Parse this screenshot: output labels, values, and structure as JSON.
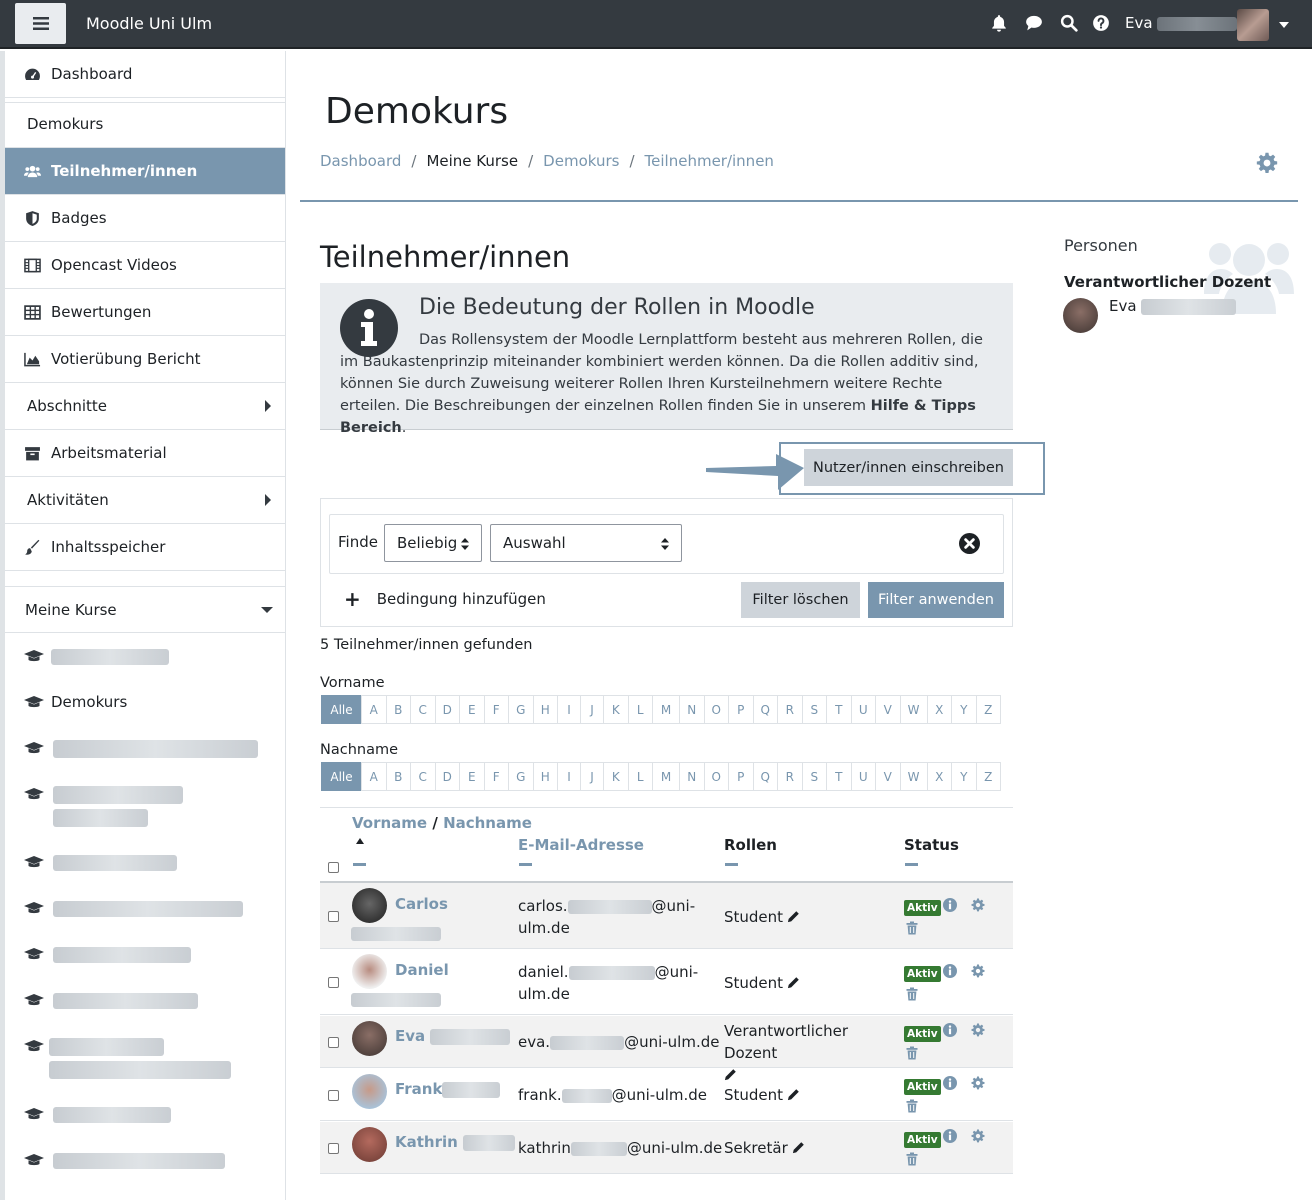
{
  "navbar": {
    "brand": "Moodle Uni Ulm",
    "user_name": "Eva"
  },
  "drawer": {
    "items": [
      {
        "label": "Dashboard",
        "icon": "dashboard-icon"
      },
      {
        "label": "Demokurs"
      },
      {
        "label": "Teilnehmer/innen",
        "icon": "users-icon",
        "active": true
      },
      {
        "label": "Badges",
        "icon": "shield-icon"
      },
      {
        "label": "Opencast Videos",
        "icon": "film-icon"
      },
      {
        "label": "Bewertungen",
        "icon": "table-icon"
      },
      {
        "label": "Votierübung Bericht",
        "icon": "area-chart-icon"
      },
      {
        "label": "Abschnitte"
      },
      {
        "label": "Arbeitsmaterial",
        "icon": "archive-icon"
      },
      {
        "label": "Aktivitäten"
      },
      {
        "label": "Inhaltsspeicher",
        "icon": "paint-brush-icon"
      }
    ],
    "my_courses_label": "Meine Kurse",
    "demokurs_course": "Demokurs"
  },
  "header": {
    "course_title": "Demokurs",
    "breadcrumb": [
      "Dashboard",
      "Meine Kurse",
      "Demokurs",
      "Teilnehmer/innen"
    ]
  },
  "main": {
    "heading": "Teilnehmer/innen",
    "info_title": "Die Bedeutung der Rollen in Moodle",
    "info_text": "Das Rollensystem der Moodle Lernplattform besteht aus mehreren Rollen, die im Baukastenprinzip miteinander kombiniert werden können. Da die Rollen additiv sind, können Sie durch Zuweisung weiterer Rollen Ihren Kursteilnehmern weitere Rechte erteilen. Die Beschreibungen der einzelnen Rollen finden Sie in unserem ",
    "info_link": "Hilfe & Tipps Bereich",
    "info_end": ".",
    "enrol_button": "Nutzer/innen einschreiben"
  },
  "filter": {
    "finde_label": "Finde",
    "match_select": "Beliebig",
    "type_select": "Auswahl",
    "add_condition": "Bedingung hinzufügen",
    "clear_button": "Filter löschen",
    "apply_button": "Filter anwenden"
  },
  "results": {
    "count_text": "5 Teilnehmer/innen gefunden"
  },
  "initials": {
    "firstname_label": "Vorname",
    "lastname_label": "Nachname",
    "all_label": "Alle",
    "letters": [
      "A",
      "B",
      "C",
      "D",
      "E",
      "F",
      "G",
      "H",
      "I",
      "J",
      "K",
      "L",
      "M",
      "N",
      "O",
      "P",
      "Q",
      "R",
      "S",
      "T",
      "U",
      "V",
      "W",
      "X",
      "Y",
      "Z"
    ]
  },
  "table": {
    "col_firstname": "Vorname",
    "col_slash": "/",
    "col_lastname": "Nachname",
    "col_email": "E-Mail-Adresse",
    "col_roles": "Rollen",
    "col_status": "Status",
    "status_badge": "Aktiv",
    "rows": [
      {
        "name": "Carlos",
        "email_start": "carlos.",
        "email_end": "@uni-",
        "email_line2": "ulm.de",
        "role": "Student"
      },
      {
        "name": "Daniel",
        "email_start": "daniel.",
        "email_end": "@uni-",
        "email_line2": "ulm.de",
        "role": "Student"
      },
      {
        "name": "Eva",
        "email_start": "eva.",
        "email_end": "@uni-ulm.de",
        "email_line2": "",
        "role": "Verantwortlicher Dozent"
      },
      {
        "name": "Frank",
        "email_start": "frank.",
        "email_end": "@uni-ulm.de",
        "email_line2": "",
        "role": "Student"
      },
      {
        "name": "Kathrin",
        "email_start": "kathrin",
        "email_end": "@uni-ulm.de",
        "email_line2": "",
        "role": "Sekretär"
      }
    ]
  },
  "block": {
    "title": "Personen",
    "role": "Verantwortlicher Dozent",
    "user": "Eva"
  },
  "colors": {
    "navbar": "#343a40",
    "accent": "#7996ae",
    "badge_green": "#357a32",
    "info_bg": "#e9ecef"
  }
}
